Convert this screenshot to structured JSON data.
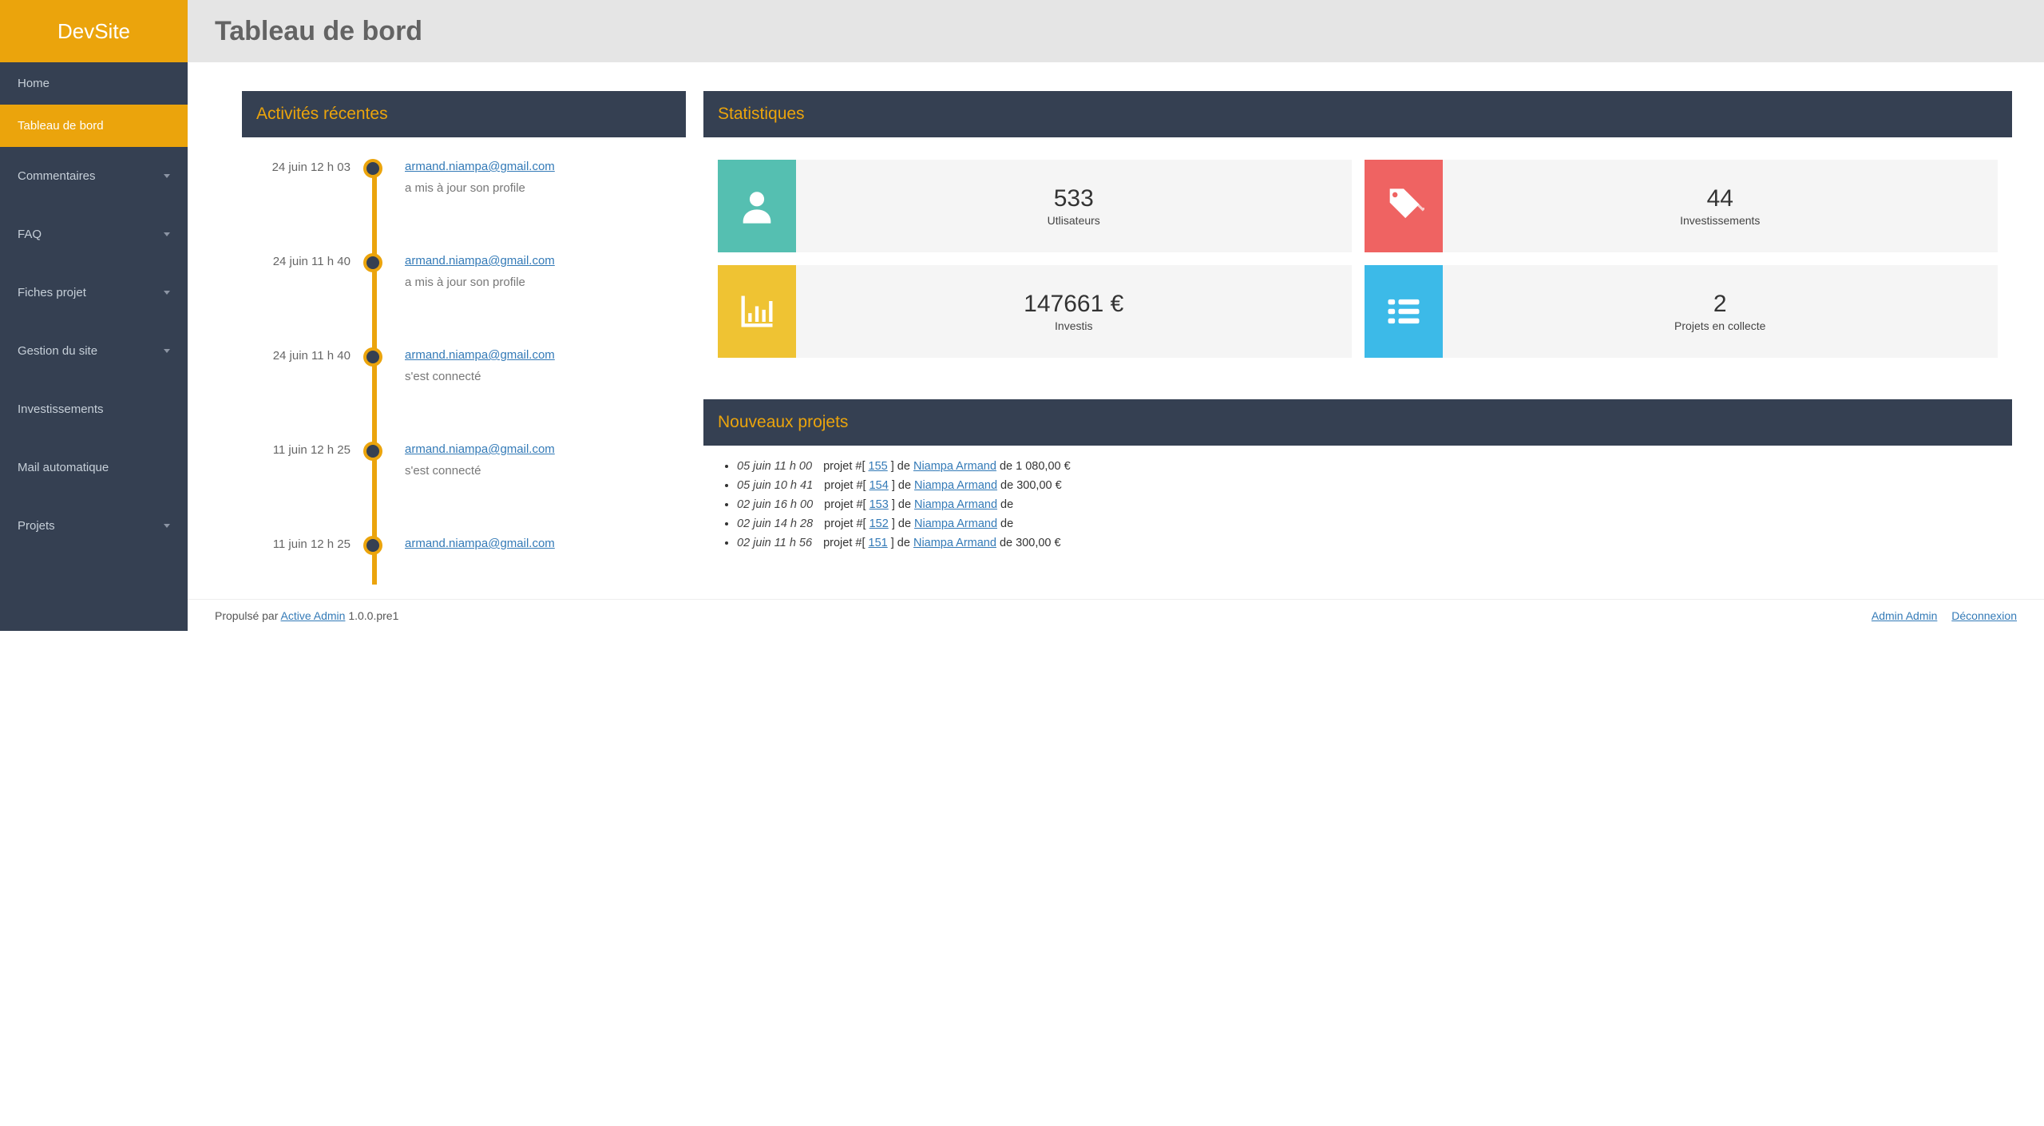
{
  "brand": "DevSite",
  "page_title": "Tableau de bord",
  "sidebar": {
    "items": [
      {
        "label": "Home",
        "caret": false
      },
      {
        "label": "Tableau de bord",
        "caret": false,
        "active": true
      },
      {
        "label": "Commentaires",
        "caret": true
      },
      {
        "label": "FAQ",
        "caret": true
      },
      {
        "label": "Fiches projet",
        "caret": true
      },
      {
        "label": "Gestion du site",
        "caret": true
      },
      {
        "label": "Investissements",
        "caret": false
      },
      {
        "label": "Mail automatique",
        "caret": false
      },
      {
        "label": "Projets",
        "caret": true
      }
    ]
  },
  "activities": {
    "title": "Activités récentes",
    "items": [
      {
        "time": "24 juin 12 h 03",
        "user": "armand.niampa@gmail.com",
        "desc": "a mis à jour son profile"
      },
      {
        "time": "24 juin 11 h 40",
        "user": "armand.niampa@gmail.com",
        "desc": "a mis à jour son profile"
      },
      {
        "time": "24 juin 11 h 40",
        "user": "armand.niampa@gmail.com",
        "desc": "s'est connecté"
      },
      {
        "time": "11 juin 12 h 25",
        "user": "armand.niampa@gmail.com",
        "desc": "s'est connecté"
      },
      {
        "time": "11 juin 12 h 25",
        "user": "armand.niampa@gmail.com",
        "desc": ""
      }
    ]
  },
  "stats": {
    "title": "Statistiques",
    "cards": [
      {
        "value": "533",
        "label": "Utlisateurs",
        "icon": "user-icon",
        "color": "bg-teal"
      },
      {
        "value": "44",
        "label": "Investissements",
        "icon": "tags-icon",
        "color": "bg-red"
      },
      {
        "value": "147661 €",
        "label": "Investis",
        "icon": "barchart-icon",
        "color": "bg-yellow"
      },
      {
        "value": "2",
        "label": "Projets en collecte",
        "icon": "list-icon",
        "color": "bg-blue"
      }
    ]
  },
  "new_projects": {
    "title": "Nouveaux projets",
    "prefix": "projet #[",
    "suffix_de": "] de",
    "amount_prefix": "de",
    "items": [
      {
        "date": "05 juin 11 h 00",
        "id": "155",
        "author": "Niampa Armand",
        "amount": "1 080,00 €"
      },
      {
        "date": "05 juin 10 h 41",
        "id": "154",
        "author": "Niampa Armand",
        "amount": "300,00 €"
      },
      {
        "date": "02 juin 16 h 00",
        "id": "153",
        "author": "Niampa Armand",
        "amount": ""
      },
      {
        "date": "02 juin 14 h 28",
        "id": "152",
        "author": "Niampa Armand",
        "amount": ""
      },
      {
        "date": "02 juin 11 h 56",
        "id": "151",
        "author": "Niampa Armand",
        "amount": "300,00 €"
      }
    ]
  },
  "footer": {
    "powered_prefix": "Propulsé par ",
    "powered_link": "Active Admin",
    "powered_suffix": " 1.0.0.pre1",
    "user_link": "Admin Admin",
    "logout_link": "Déconnexion"
  }
}
